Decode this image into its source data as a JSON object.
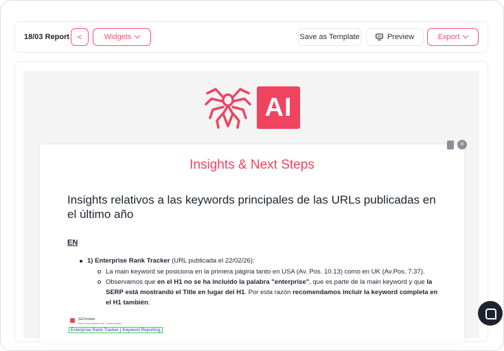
{
  "toolbar": {
    "report_title": "18/03 Report",
    "back_glyph": "<",
    "widgets_label": "Widgets",
    "save_template_label": "Save as Template",
    "preview_label": "Preview",
    "export_label": "Export"
  },
  "logo": {
    "text": "AI",
    "accent_color": "#f0435f",
    "icon": "spider-icon"
  },
  "card": {
    "section_title": "Insights & Next Steps",
    "heading": "Insights relativos a las keywords principales de las URLs publicadas en el último año",
    "language": "EN",
    "item1_title": "1) Enterprise Rank Tracker",
    "item1_meta": " (URL publicada el 22/02/26):",
    "sub1": "La main keyword se posiciona en la primera página tanto en USA (Av. Pos. 10.13) como en UK (Av.Pos. 7.37).",
    "sub2_a": "Observamos que ",
    "sub2_b": "en el H1 no se ha incluido la palabra \"enterprise\"",
    "sub2_c": ", que es parte de la main keyword y que ",
    "sub2_d": "la SERP está mostrando el Title en lugar del H1",
    "sub2_e": ". Por esta razón ",
    "sub2_f": "recomendamos incluir la keyword completa en el H1 también",
    "sub2_g": ".",
    "serp_site": "SEOmrkter",
    "serp_url": "https://seomrkter.com › rank-tracker",
    "serp_title": "Enterprise Rank Tracker | Keyword Reporting"
  }
}
